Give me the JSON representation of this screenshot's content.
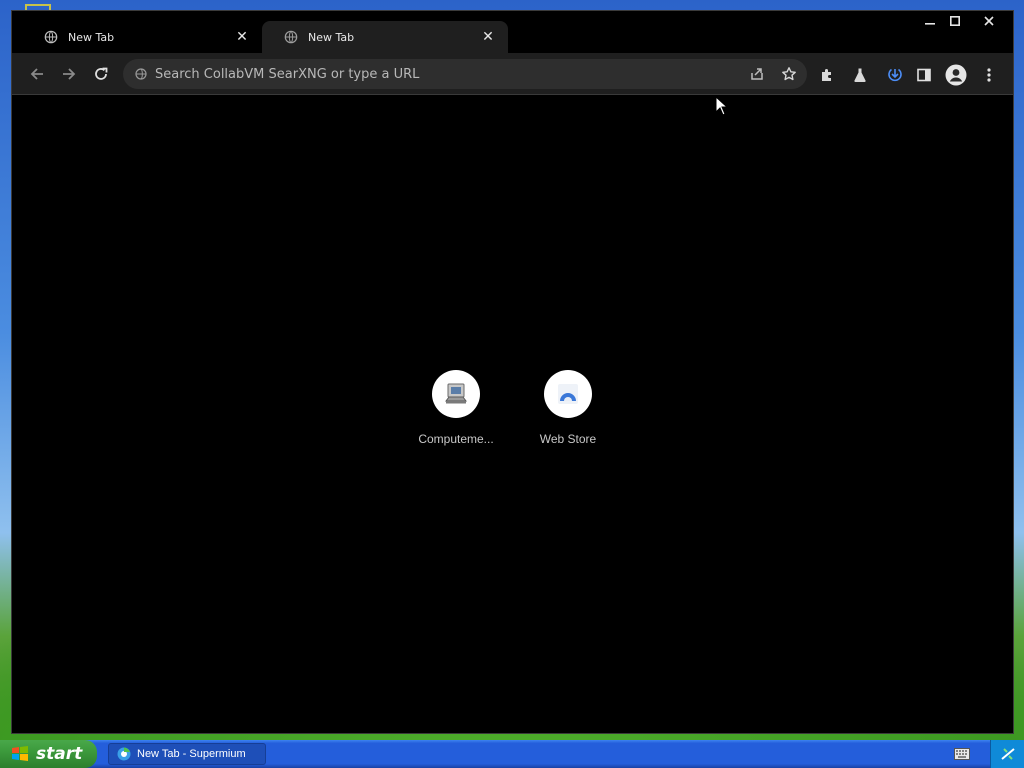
{
  "browser": {
    "tabs": [
      {
        "title": "New Tab",
        "active": false
      },
      {
        "title": "New Tab",
        "active": true
      }
    ],
    "omnibox": {
      "placeholder": "Search CollabVM SearXNG or type a URL"
    }
  },
  "ntp": {
    "shortcuts": [
      {
        "label": "Computeme...",
        "icon": "computer-icon"
      },
      {
        "label": "Web Store",
        "icon": "web-store-icon"
      }
    ]
  },
  "taskbar": {
    "start_label": "start",
    "tasks": [
      {
        "label": "New Tab - Supermium"
      }
    ]
  },
  "colors": {
    "tab_active_bg": "#1f1f1f",
    "toolbar_bg": "#1f1f1f",
    "omnibox_bg": "#2e2e2e",
    "page_bg": "#000000",
    "accent": "#4c8df6",
    "taskbar_blue": "#245edb",
    "start_green": "#3c9a3c"
  }
}
